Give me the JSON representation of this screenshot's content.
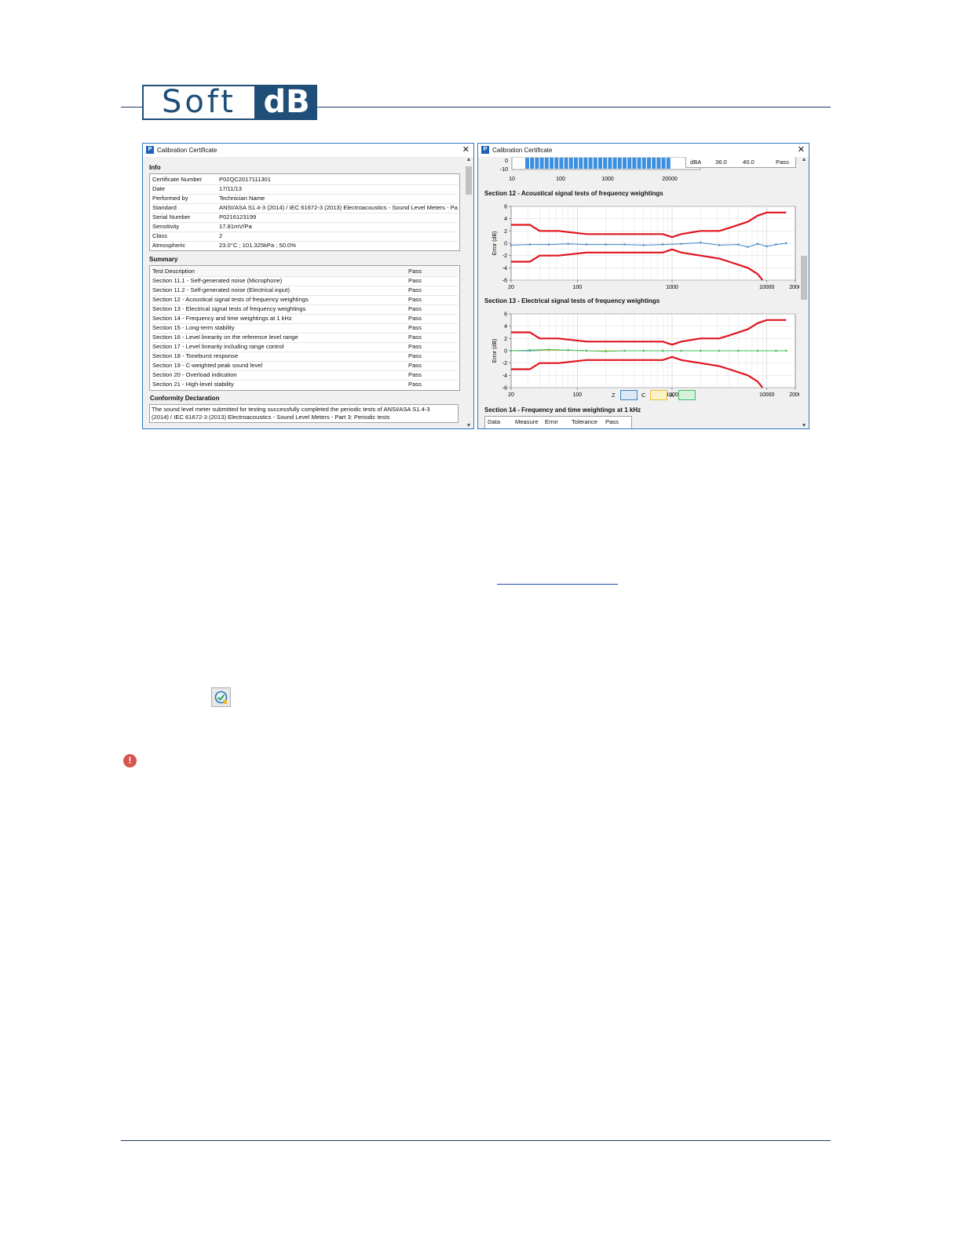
{
  "logo": {
    "part1": "Soft",
    "part2": "dB"
  },
  "left_window": {
    "title": "Calibration Certificate",
    "info": {
      "heading": "Info",
      "rows": [
        {
          "label": "Certificate Number",
          "value": "P02QC2017111301"
        },
        {
          "label": "Date",
          "value": "17/11/13"
        },
        {
          "label": "Performed by",
          "value": "Technician Name"
        },
        {
          "label": "Standard",
          "value": "ANSI/ASA S1.4-3 (2014) / IEC 61672-3 (2013) Electroacoustics - Sound Level Meters - Pa"
        },
        {
          "label": "Serial Number",
          "value": "P0216123199"
        },
        {
          "label": "Sensitivity",
          "value": "17.81mV/Pa"
        },
        {
          "label": "Class",
          "value": "2"
        },
        {
          "label": "Atmospheric",
          "value": "23.0°C ; 101.325kPa ; 50.0%"
        }
      ]
    },
    "summary": {
      "heading": "Summary",
      "header": {
        "desc": "Test Description",
        "result": "Pass"
      },
      "rows": [
        {
          "desc": "Section 11.1 - Self-generated noise (Microphone)",
          "result": "Pass"
        },
        {
          "desc": "Section 11.2 - Self-generated noise (Electrical input)",
          "result": "Pass"
        },
        {
          "desc": "Section 12 - Acoustical signal tests of frequency weightings",
          "result": "Pass"
        },
        {
          "desc": "Section 13 - Electrical signal tests of frequency weightings",
          "result": "Pass"
        },
        {
          "desc": "Section 14 - Frequency and time weightings at 1 kHz",
          "result": "Pass"
        },
        {
          "desc": "Section 15 - Long-term stability",
          "result": "Pass"
        },
        {
          "desc": "Section 16 - Level linearity on the reference level range",
          "result": "Pass"
        },
        {
          "desc": "Section 17 - Level linearity including range control",
          "result": "Pass"
        },
        {
          "desc": "Section 18 - Toneburst response",
          "result": "Pass"
        },
        {
          "desc": "Section 19 - C-weighted peak sound level",
          "result": "Pass"
        },
        {
          "desc": "Section 20 - Overload indication",
          "result": "Pass"
        },
        {
          "desc": "Section 21 - High-level stability",
          "result": "Pass"
        }
      ]
    },
    "conformity": {
      "heading": "Conformity Declaration",
      "line1": "The sound level meter submitted for testing successfully completed the periodic tests of ANSI/ASA S1.4-3",
      "line2": "(2014) / IEC 61672-3 (2013) Electroacoustics - Sound Level Meters - Part 3: Periodic tests"
    }
  },
  "right_window": {
    "title": "Calibration Certificate",
    "top_strip": {
      "y_ticks": [
        "0",
        "-10"
      ],
      "x_ticks": [
        "10",
        "100",
        "1000",
        "20000"
      ],
      "table_row": [
        "dBA",
        "36.0",
        "40.0",
        "Pass"
      ]
    },
    "section12_title": "Section 12 - Acoustical signal tests of frequency weightings",
    "section13_title": "Section 13 - Electrical signal tests of frequency weightings",
    "section14_title": "Section 14 - Frequency and time weightings at 1 kHz",
    "section14_headers": [
      "Data",
      "Measure",
      "Error",
      "Tolerance",
      "Pass"
    ],
    "legend": {
      "z": "Z",
      "c": "C",
      "a": "A"
    }
  },
  "chart_data": [
    {
      "type": "line",
      "title": "Section 12 - Acoustical signal tests of frequency weightings",
      "ylabel": "Error (dB)",
      "xlabel": "",
      "xscale": "log",
      "xlim": [
        20,
        20000
      ],
      "ylim": [
        -6,
        6
      ],
      "x_tick_labels": [
        "20",
        "100",
        "1000",
        "10000",
        "2000"
      ],
      "x_tick_values": [
        20,
        100,
        1000,
        10000,
        20000
      ],
      "y_tick_labels": [
        "6",
        "4",
        "2",
        "0",
        "-2",
        "-4",
        "-6"
      ],
      "grid": true,
      "series": [
        {
          "role": "upper-limit",
          "color": "#e0141e",
          "x": [
            20,
            31.5,
            40,
            63,
            125,
            250,
            500,
            800,
            1000,
            1250,
            2000,
            3150,
            4000,
            6300,
            8000,
            10000,
            12500,
            16000
          ],
          "values": [
            3,
            3,
            2,
            2,
            1.5,
            1.5,
            1.5,
            1.5,
            1,
            1.5,
            2,
            2,
            2.5,
            3.5,
            4.5,
            5,
            5,
            5
          ]
        },
        {
          "role": "lower-limit",
          "color": "#e0141e",
          "x": [
            20,
            31.5,
            40,
            63,
            125,
            250,
            500,
            800,
            1000,
            1250,
            2000,
            3150,
            4000,
            6300,
            8000,
            9000
          ],
          "values": [
            -3,
            -3,
            -2,
            -2,
            -1.5,
            -1.5,
            -1.5,
            -1.5,
            -1,
            -1.5,
            -2,
            -2.5,
            -3,
            -4,
            -5,
            -6
          ]
        },
        {
          "role": "measured",
          "color": "#3b84c4",
          "x": [
            20,
            31.5,
            50,
            80,
            125,
            200,
            315,
            500,
            800,
            1250,
            2000,
            3150,
            5000,
            6300,
            8000,
            10000,
            12500,
            16000
          ],
          "values": [
            -0.3,
            -0.2,
            -0.2,
            -0.1,
            -0.2,
            -0.2,
            -0.2,
            -0.3,
            -0.2,
            -0.1,
            0.1,
            -0.3,
            -0.2,
            -0.6,
            -0.1,
            -0.5,
            -0.2,
            0
          ]
        }
      ]
    },
    {
      "type": "line",
      "title": "Section 13 - Electrical signal tests of frequency weightings",
      "ylabel": "Error (dB)",
      "xlabel": "",
      "xscale": "log",
      "xlim": [
        20,
        20000
      ],
      "ylim": [
        -6,
        6
      ],
      "x_tick_labels": [
        "20",
        "100",
        "1000",
        "10000",
        "2000"
      ],
      "x_tick_values": [
        20,
        100,
        1000,
        10000,
        20000
      ],
      "y_tick_labels": [
        "6",
        "4",
        "2",
        "0",
        "-2",
        "-4",
        "-6"
      ],
      "grid": true,
      "legend_position": "bottom-center",
      "series": [
        {
          "role": "upper-limit",
          "color": "#e0141e",
          "x": [
            20,
            31.5,
            40,
            63,
            125,
            250,
            500,
            800,
            1000,
            1250,
            2000,
            3150,
            4000,
            6300,
            8000,
            10000,
            12500,
            16000
          ],
          "values": [
            3,
            3,
            2,
            2,
            1.5,
            1.5,
            1.5,
            1.5,
            1,
            1.5,
            2,
            2,
            2.5,
            3.5,
            4.5,
            5,
            5,
            5
          ]
        },
        {
          "role": "lower-limit",
          "color": "#e0141e",
          "x": [
            20,
            31.5,
            40,
            63,
            125,
            250,
            500,
            800,
            1000,
            1250,
            2000,
            3150,
            4000,
            6300,
            8000,
            9000
          ],
          "values": [
            -3,
            -3,
            -2,
            -2,
            -1.5,
            -1.5,
            -1.5,
            -1.5,
            -1,
            -1.5,
            -2,
            -2.5,
            -3,
            -4,
            -5,
            -6
          ]
        },
        {
          "name": "Z",
          "color": "#3b84c4",
          "x": [
            20,
            31.5,
            50,
            80,
            125,
            200,
            315,
            500,
            800,
            1250,
            2000,
            3150,
            5000,
            8000,
            12500,
            16000
          ],
          "values": [
            0,
            0,
            0.1,
            0.1,
            0,
            0,
            0,
            0,
            0,
            0,
            0,
            0,
            0,
            0,
            0,
            0
          ]
        },
        {
          "name": "C",
          "color": "#e8c238",
          "x": [
            20,
            31.5,
            50,
            80,
            125,
            200,
            315,
            500,
            800,
            1250,
            2000,
            3150,
            5000,
            8000,
            12500,
            16000
          ],
          "values": [
            0,
            0.1,
            0.1,
            0.1,
            0,
            0,
            0,
            0,
            0,
            0,
            0,
            0,
            0,
            0,
            0,
            0
          ]
        },
        {
          "name": "A",
          "color": "#3fbf5f",
          "x": [
            20,
            31.5,
            50,
            80,
            125,
            200,
            315,
            500,
            800,
            1250,
            2000,
            3150,
            5000,
            8000,
            12500,
            16000
          ],
          "values": [
            0,
            0.1,
            0.2,
            0.1,
            0,
            -0.1,
            0,
            0,
            0,
            0,
            0,
            0,
            0,
            0,
            0,
            0
          ]
        }
      ]
    }
  ]
}
